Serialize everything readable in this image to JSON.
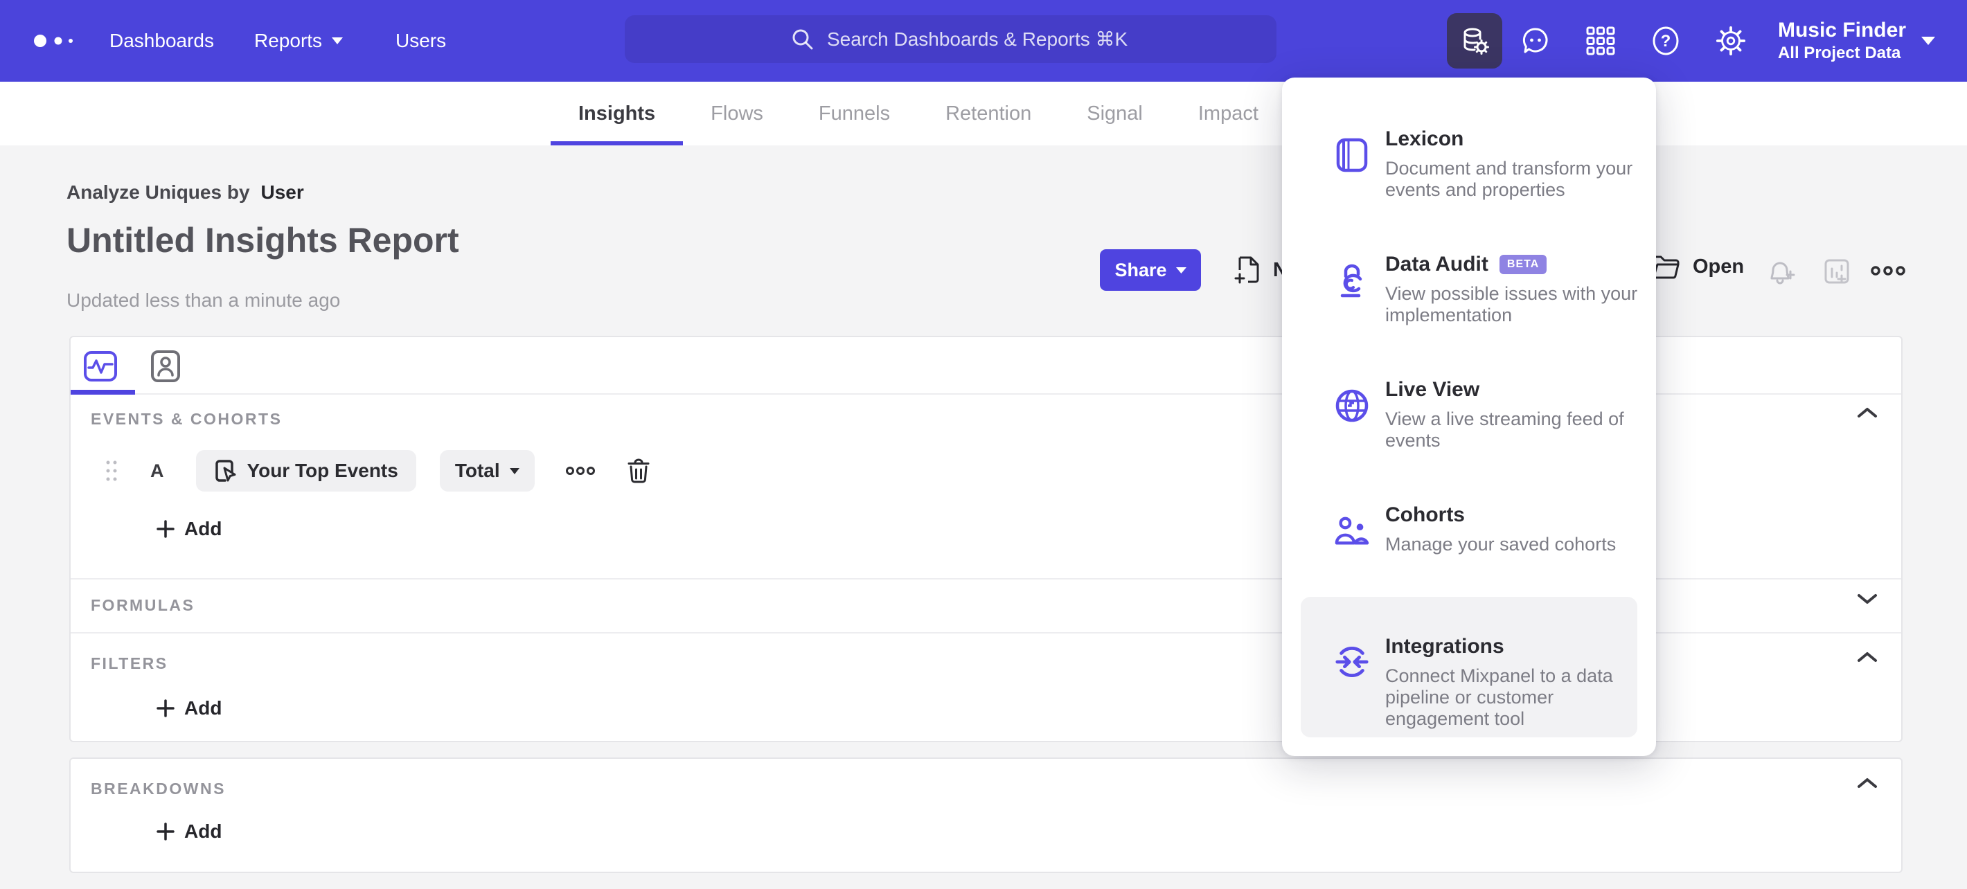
{
  "topbar": {
    "nav": [
      {
        "label": "Dashboards"
      },
      {
        "label": "Reports"
      },
      {
        "label": "Users"
      }
    ],
    "search_placeholder": "Search Dashboards & Reports ⌘K",
    "project": {
      "name": "Music Finder",
      "scope": "All Project Data"
    }
  },
  "tabs": [
    {
      "label": "Insights",
      "active": true
    },
    {
      "label": "Flows",
      "active": false
    },
    {
      "label": "Funnels",
      "active": false
    },
    {
      "label": "Retention",
      "active": false
    },
    {
      "label": "Signal",
      "active": false
    },
    {
      "label": "Impact",
      "active": false
    }
  ],
  "report": {
    "analyze_prefix": "Analyze Uniques by",
    "analyze_value": "User",
    "title": "Untitled Insights Report",
    "updated": "Updated less than a minute ago",
    "share_label": "Share",
    "new_label": "New",
    "open_label": "Open"
  },
  "builder": {
    "events_label": "EVENTS & COHORTS",
    "row": {
      "letter": "A",
      "event_name": "Your Top Events",
      "metric": "Total"
    },
    "add_label": "Add",
    "formulas_label": "FORMULAS",
    "filters_label": "FILTERS",
    "breakdowns_label": "BREAKDOWNS"
  },
  "data_menu": {
    "items": [
      {
        "title": "Lexicon",
        "desc": "Document and transform your events and properties"
      },
      {
        "title": "Data Audit",
        "badge": "BETA",
        "desc": "View possible issues with your implementation"
      },
      {
        "title": "Live View",
        "desc": "View a live streaming feed of events"
      },
      {
        "title": "Cohorts",
        "desc": "Manage your saved cohorts"
      },
      {
        "title": "Integrations",
        "desc": "Connect Mixpanel to a data pipeline or customer engagement tool"
      }
    ]
  },
  "icons": {
    "help_glyph": "?"
  },
  "colors": {
    "topbar": "#4b44db",
    "accent": "#4f44e0",
    "search_bg": "#453dc8",
    "active_icon_bg": "#3b3563",
    "badge_bg": "#8f83e3",
    "page_bg": "#f4f4f5",
    "panel_hover_bg": "#f2f2f4",
    "panel_icon": "#5b4ee9"
  }
}
